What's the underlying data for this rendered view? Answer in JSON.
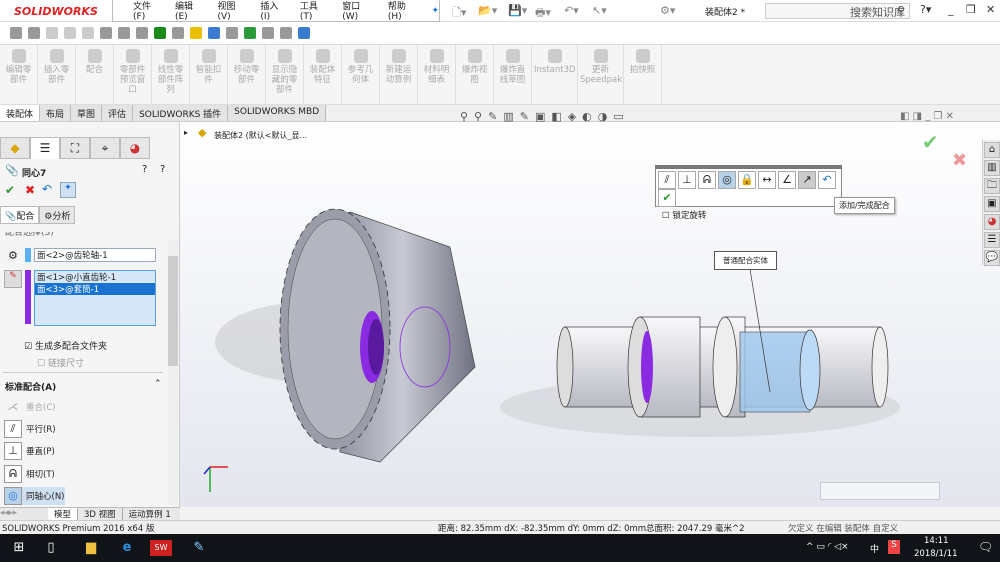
{
  "app": {
    "brand": "SOLIDWORKS",
    "document_title": "装配体2 *",
    "search_placeholder": "搜索知识库"
  },
  "menu": [
    "文件(F)",
    "编辑(E)",
    "视图(V)",
    "插入(I)",
    "工具(T)",
    "窗口(W)",
    "帮助(H)"
  ],
  "command_manager": [
    "编辑零部件",
    "插入零部件",
    "配合",
    "零部件预览窗口",
    "线性零部件阵列",
    "智能扣件",
    "移动零部件",
    "显示隐藏的零部件",
    "装配体特征",
    "参考几何体",
    "新建运动算例",
    "材料明细表",
    "爆炸视图",
    "爆炸直线草图",
    "Instant3D",
    "更新Speedpak",
    "拍快照"
  ],
  "tabs": [
    "装配体",
    "布局",
    "草图",
    "评估",
    "SOLIDWORKS 插件",
    "SOLIDWORKS MBD"
  ],
  "feature_tree": {
    "root": "装配体2 (默认<默认_显..."
  },
  "property_manager": {
    "title": "同心7",
    "subtabs": [
      "配合",
      "分析"
    ],
    "section_selections": "配合选择(S)",
    "selection_1": "面<2>@齿轮轴-1",
    "selection_2": [
      "面<1>@小直齿轮-1",
      "面<3>@套筒-1"
    ],
    "make_folder": {
      "label": "生成多配合文件夹",
      "checked": true
    },
    "link_dims": {
      "label": "链接尺寸",
      "checked": false
    },
    "section_standard": "标准配合(A)",
    "standard_mates": [
      "重合(C)",
      "平行(R)",
      "垂直(P)",
      "相切(T)",
      "同轴心(N)"
    ]
  },
  "mate_popup": {
    "lock_rotation": "锁定旋转",
    "tooltip": "添加/完成配合"
  },
  "callout": "普通配合实体",
  "bottom_tabs": [
    "模型",
    "3D 视图",
    "运动算例 1"
  ],
  "status": {
    "product": "SOLIDWORKS Premium 2016 x64 版",
    "measure": "距离: 82.35mm   dX: -82.35mm  dY: 0mm  dZ: 0mm总面积: 2047.29 毫米^2",
    "extra": "欠定义   在编辑 装配体   自定义"
  },
  "taskbar": {
    "time": "14:11",
    "date": "2018/1/11",
    "ime": "中"
  },
  "colors": {
    "accent": "#d22",
    "selection": "#8a2be2",
    "highlight": "#1a73d0"
  }
}
